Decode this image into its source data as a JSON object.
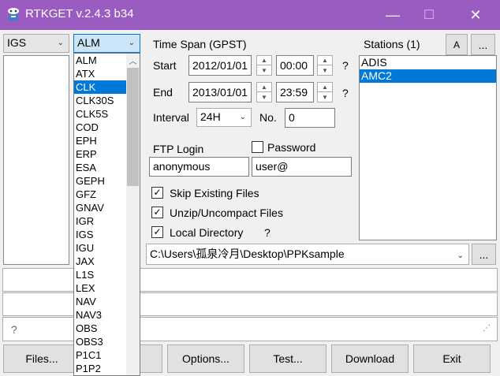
{
  "titlebar": {
    "title": "RTKGET v.2.4.3 b34",
    "minimize": "—",
    "maximize": "☐",
    "close": "✕"
  },
  "left": {
    "source_select": "IGS",
    "type_select": "ALM",
    "dropdown_items": [
      "ALM",
      "ATX",
      "CLK",
      "CLK30S",
      "CLK5S",
      "COD",
      "EPH",
      "ERP",
      "ESA",
      "GEPH",
      "GFZ",
      "GNAV",
      "IGR",
      "IGS",
      "IGU",
      "JAX",
      "L1S",
      "LEX",
      "NAV",
      "NAV3",
      "OBS",
      "OBS3",
      "P1C1",
      "P1P2"
    ],
    "dropdown_selected": "CLK"
  },
  "timespan": {
    "label": "Time Span (GPST)",
    "start_label": "Start",
    "start_date": "2012/01/01",
    "start_time": "00:00",
    "end_label": "End",
    "end_date": "2013/01/01",
    "end_time": "23:59",
    "help": "?",
    "interval_label": "Interval",
    "interval_value": "24H",
    "no_label": "No.",
    "no_value": "0"
  },
  "ftp": {
    "login_label": "FTP Login",
    "password_label": "Password",
    "login_value": "anonymous",
    "password_value": "user@"
  },
  "options": {
    "skip_existing": "Skip Existing Files",
    "unzip": "Unzip/Uncompact Files",
    "local_dir": "Local Directory",
    "help": "?"
  },
  "stations": {
    "label": "Stations (1)",
    "a_button": "A",
    "more_button": "...",
    "items": [
      "ADIS",
      "AMC2"
    ],
    "selected": "AMC2"
  },
  "directory": {
    "path": "C:\\Users\\孤泉冷月\\Desktop\\PPKsample",
    "browse": "..."
  },
  "status": {
    "help": "?"
  },
  "buttons": {
    "files": "Files...",
    "options": "Options...",
    "test": "Test...",
    "download": "Download",
    "exit": "Exit"
  },
  "icons": {
    "app": "rtkget-app-icon",
    "chevron": "chevron-down-icon",
    "check": "checkmark-icon"
  },
  "colors": {
    "titlebar": "#9b5cc2",
    "selection": "#0078d7"
  }
}
